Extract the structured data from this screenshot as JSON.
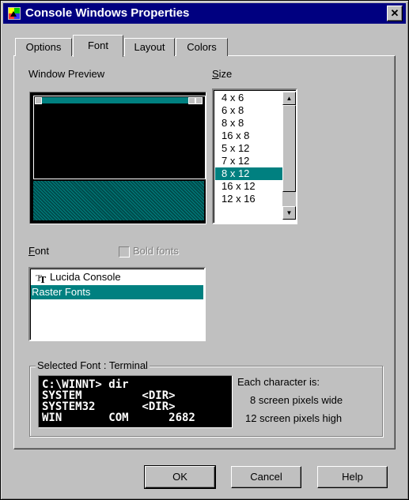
{
  "window": {
    "title": "Console Windows Properties"
  },
  "tabs": [
    {
      "label": "Options"
    },
    {
      "label": "Font"
    },
    {
      "label": "Layout"
    },
    {
      "label": "Colors"
    }
  ],
  "preview": {
    "label": "Window Preview"
  },
  "size": {
    "label": "Size",
    "items": [
      "4 x 6",
      "6 x 8",
      "8 x 8",
      "16 x 8",
      "5 x 12",
      "7 x 12",
      "8 x 12",
      "16 x 12",
      "12 x 16"
    ],
    "selected": "8 x 12"
  },
  "font": {
    "label": "Font",
    "bold_label": "Bold fonts",
    "items": [
      "Lucida Console",
      "Raster Fonts"
    ],
    "selected": "Raster Fonts"
  },
  "selected_font": {
    "group_title": "Selected Font : Terminal",
    "sample_lines": [
      "C:\\WINNT> dir",
      "SYSTEM         <DIR>",
      "SYSTEM32       <DIR>",
      "WIN       COM      2682"
    ],
    "info_title": "Each character is:",
    "width_text": "8 screen pixels wide",
    "height_text": "12 screen pixels high"
  },
  "buttons": {
    "ok": "OK",
    "cancel": "Cancel",
    "help": "Help"
  },
  "colors": {
    "title_bar": "#000080",
    "selection": "#008080",
    "face": "#c0c0c0"
  }
}
